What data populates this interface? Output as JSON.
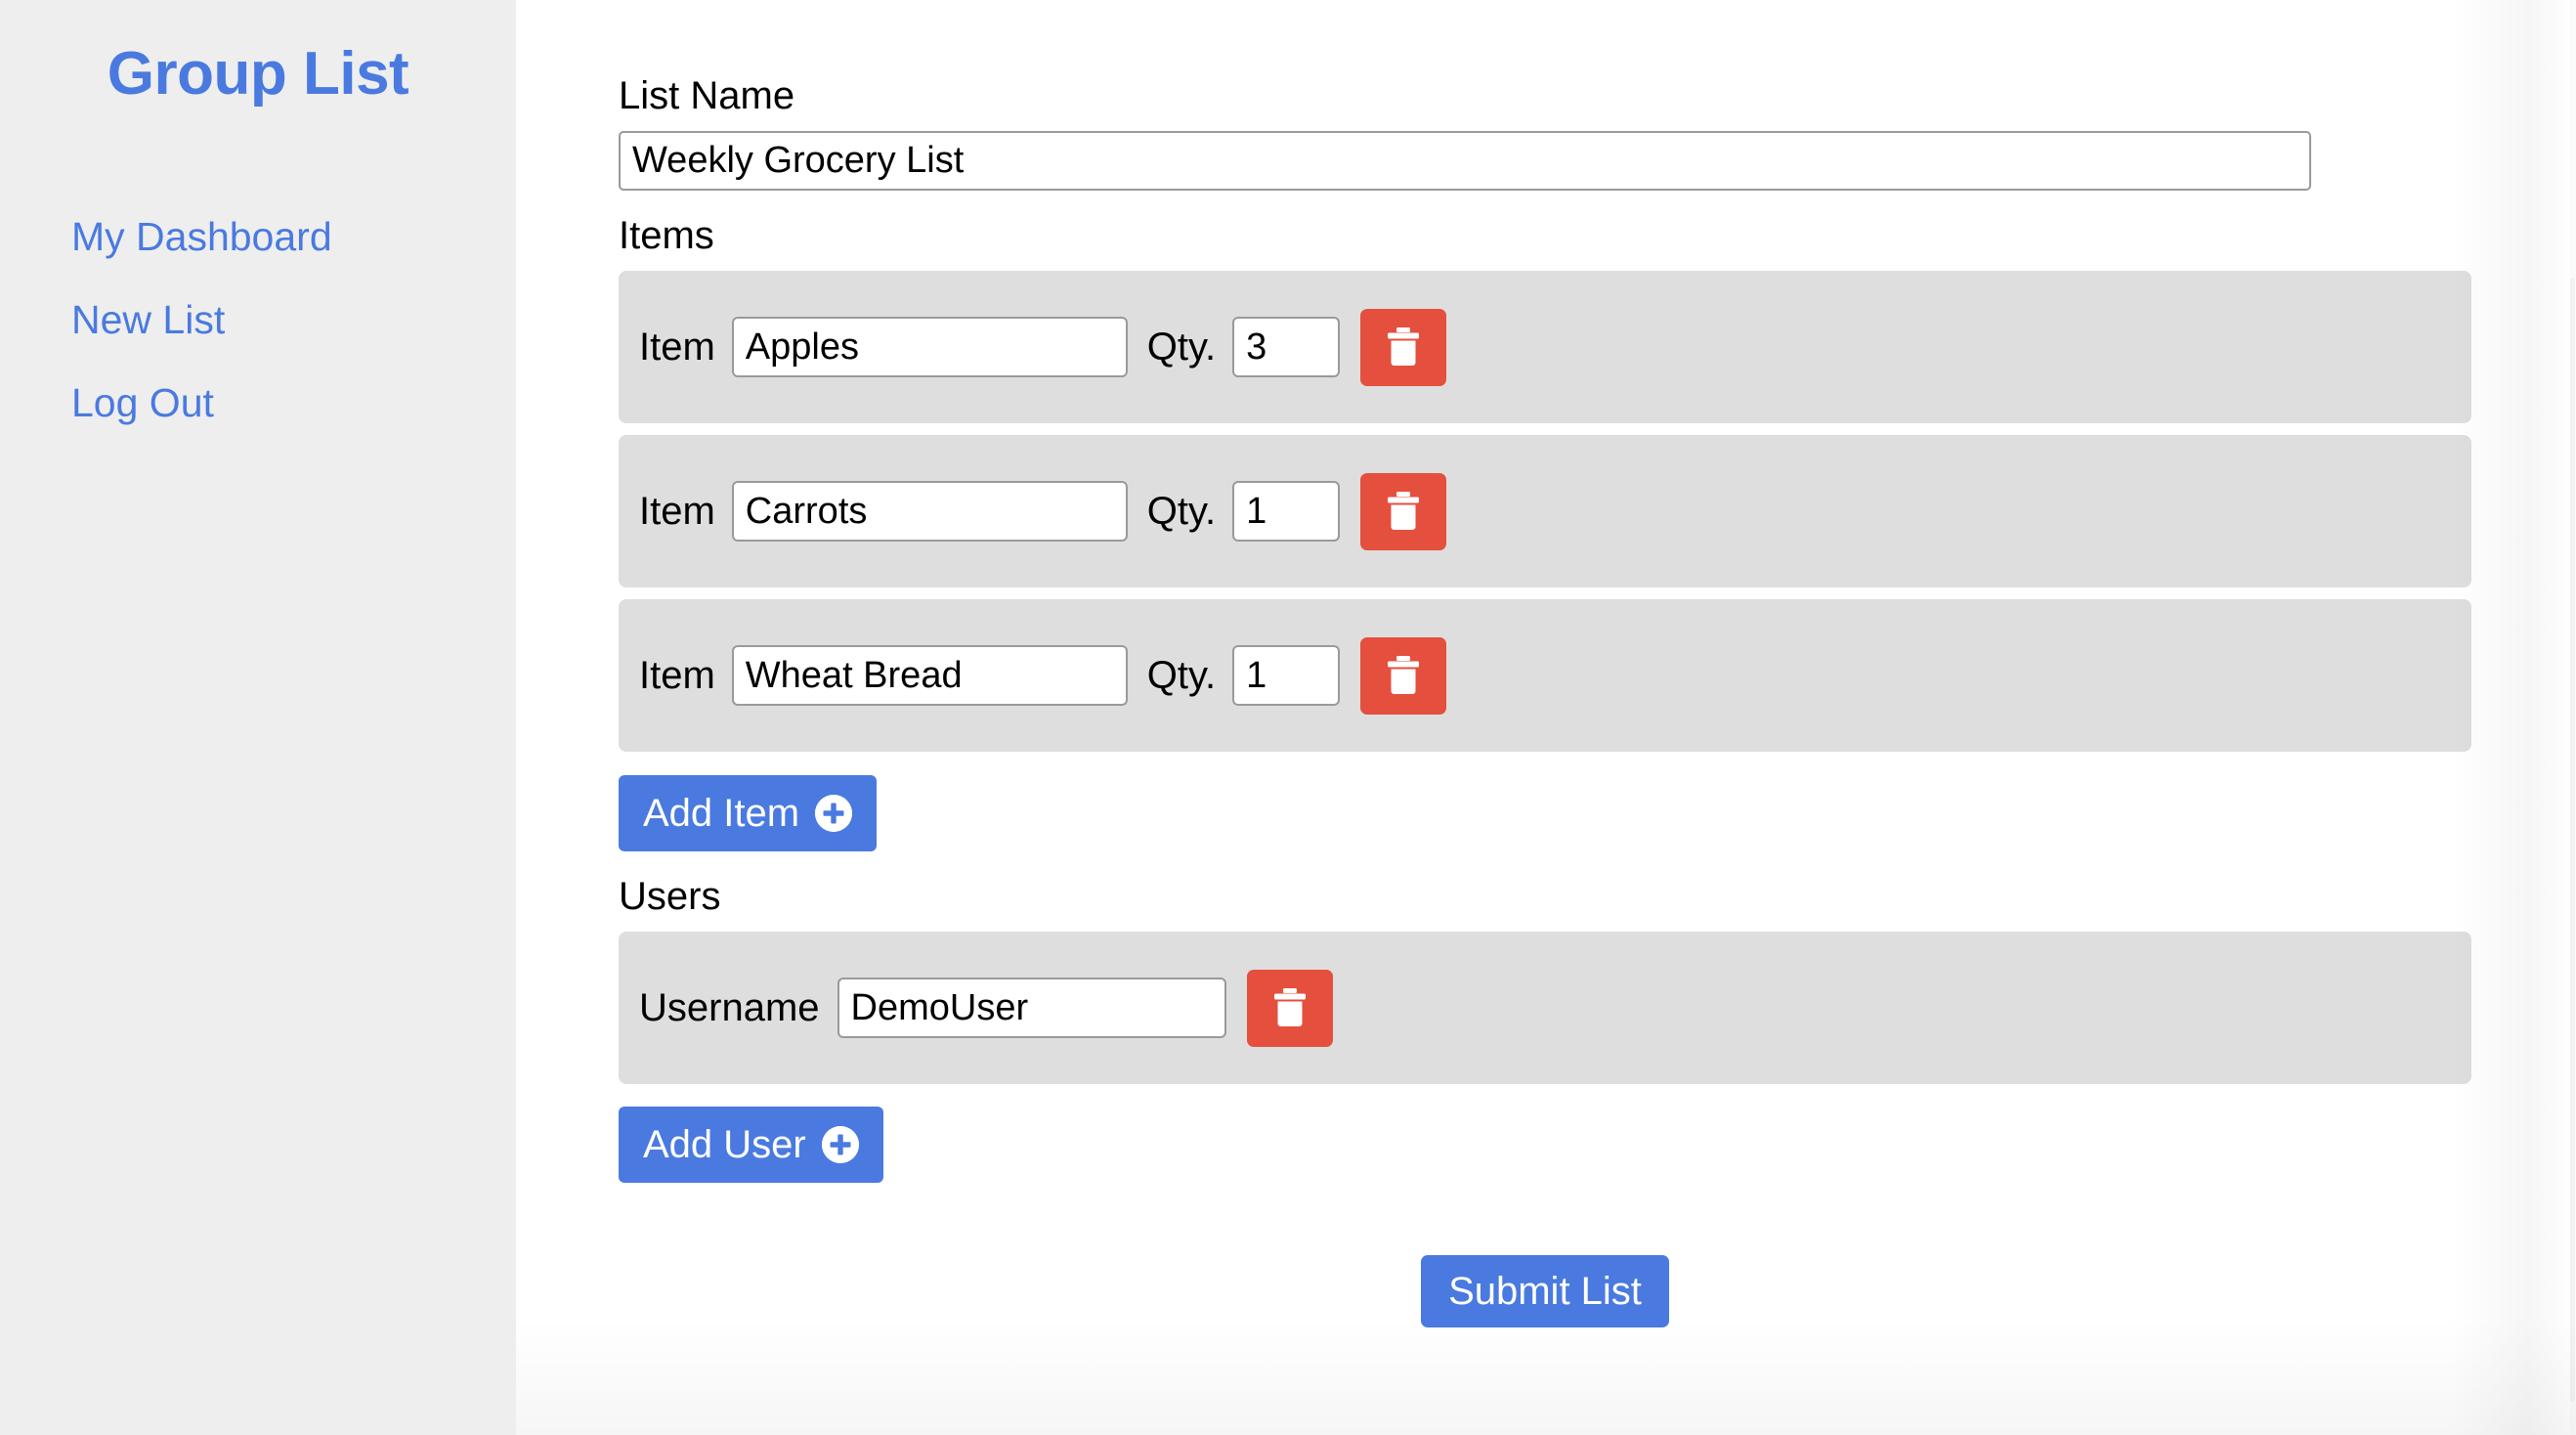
{
  "sidebar": {
    "brand": "Group List",
    "items": [
      {
        "label": "My Dashboard",
        "name": "sidebar-item-my-dashboard"
      },
      {
        "label": "New List",
        "name": "sidebar-item-new-list"
      },
      {
        "label": "Log Out",
        "name": "sidebar-item-log-out"
      }
    ]
  },
  "form": {
    "list_name_label": "List Name",
    "list_name_value": "Weekly Grocery List",
    "list_name_placeholder": "List Name",
    "items_label": "Items",
    "item_label": "Item",
    "qty_label": "Qty.",
    "items": [
      {
        "item_label": "Item",
        "item_value": "Apples",
        "qty_label": "Qty.",
        "qty_value": "3",
        "delete_icon": "trash-icon"
      },
      {
        "item_label": "Item",
        "item_value": "Carrots",
        "qty_label": "Qty.",
        "qty_value": "1",
        "delete_icon": "trash-icon"
      },
      {
        "item_label": "Item",
        "item_value": "Wheat Bread",
        "qty_label": "Qty.",
        "qty_value": "1",
        "delete_icon": "trash-icon"
      }
    ],
    "add_item_label": "Add Item",
    "add_item_icon": "plus-circle-icon",
    "users_label": "Users",
    "username_label": "Username",
    "users": [
      {
        "username_label": "Username",
        "username_value": "DemoUser",
        "delete_icon": "trash-icon"
      }
    ],
    "add_user_label": "Add User",
    "add_user_icon": "plus-circle-icon",
    "submit_label": "Submit List",
    "item_placeholder": "Item",
    "qty_placeholder": "Qty.",
    "username_placeholder": "Username"
  },
  "colors": {
    "accent_blue": "#4a7ae0",
    "danger_red": "#e44f3e",
    "sidebar_bg": "#eeeeee",
    "row_bg": "#dedede",
    "input_border": "#9a9a9a",
    "page_bg": "#ffffff",
    "text": "#000000"
  }
}
